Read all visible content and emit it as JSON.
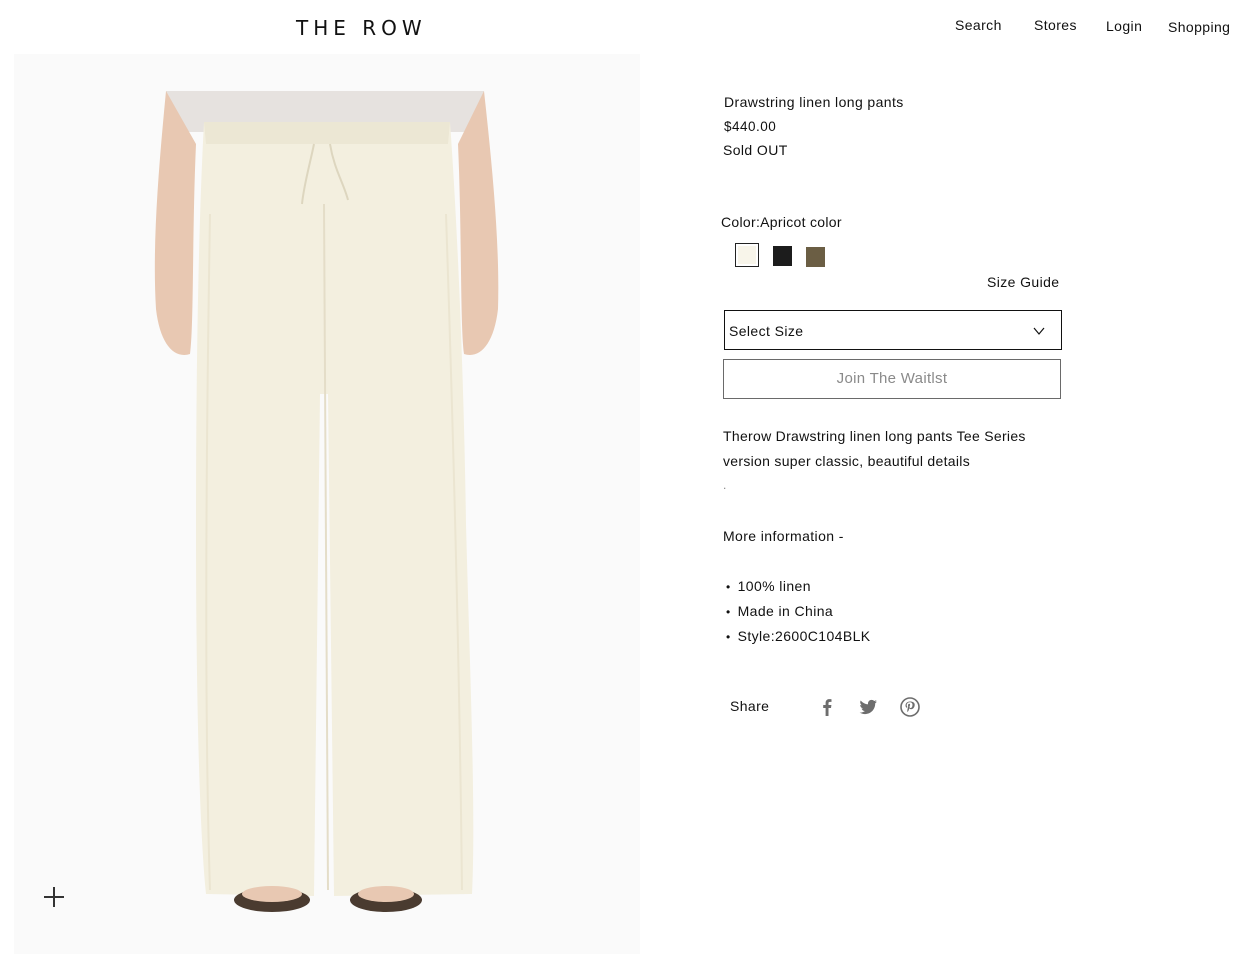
{
  "header": {
    "logo": "THE ROW",
    "nav": {
      "search": "Search",
      "stores": "Stores",
      "login": "Login",
      "shopping": "Shopping"
    }
  },
  "product": {
    "title": "Drawstring linen long pants",
    "price": "$440.00",
    "stock_status": "Sold OUT",
    "color_label": "Color:Apricot color",
    "swatches": [
      {
        "name": "Apricot color",
        "hex": "#f8f5ea",
        "selected": true
      },
      {
        "name": "Black",
        "hex": "#1c1c1c",
        "selected": false
      },
      {
        "name": "Olive brown",
        "hex": "#6b5e44",
        "selected": false
      }
    ],
    "size_guide": "Size Guide",
    "size_select": "Select Size",
    "waitlist_button": "Join  The Waitlst",
    "description_line1": "Therow Drawstring linen long pants  Tee Series",
    "description_line2": "version super classic, beautiful details",
    "description_dot": ".",
    "more_info": "More information -",
    "specs": [
      "100% linen",
      "Made in China",
      "Style:2600C104BLK"
    ],
    "share_label": "Share"
  },
  "colors": {
    "pants": "#f3efdf",
    "skin": "#e8c8b2",
    "top": "#e6e2df"
  }
}
